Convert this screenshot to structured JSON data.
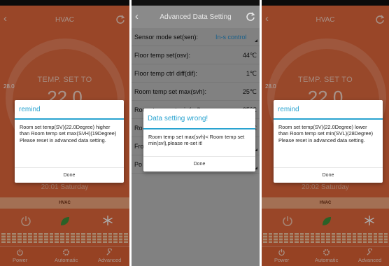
{
  "screen1": {
    "title": "HVAC",
    "temp_label": "TEMP. SET TO",
    "temp_value": "22.0",
    "left_temp": "28.0",
    "date": "20:01 Saturday",
    "hvac_bar": "HVAC",
    "nav": [
      "Power",
      "Automatic",
      "Advanced"
    ],
    "dialog": {
      "title": "remind",
      "message": "Room set temp(SV)(22.0Degree) higher than Room temp set max(SVH)(19Degree) Please reset in advanced data setting.",
      "button": "Done"
    }
  },
  "screen2": {
    "title": "Advanced Data Setting",
    "rows": [
      {
        "label": "Sensor mode set(sen):",
        "value": "In-s control"
      },
      {
        "label": "Floor temp set(osv):",
        "value": "44℃"
      },
      {
        "label": "Floor temp ctrl diff(dif):",
        "value": "1℃"
      },
      {
        "label": "Room temp set max(svh):",
        "value": "25℃"
      },
      {
        "label": "Room temp set min(svl):",
        "value": "25℃"
      },
      {
        "label": "Ro",
        "value": "℃"
      },
      {
        "label": "Fro",
        "value": ""
      },
      {
        "label": "Po",
        "value": ""
      }
    ],
    "dialog": {
      "title": "Data setting wrong!",
      "message": "Room temp set max(svh)< Room temp set min(svl),please re-set it!",
      "button": "Done"
    }
  },
  "screen3": {
    "title": "HVAC",
    "temp_label": "TEMP. SET TO",
    "temp_value": "22.0",
    "left_temp": "28.0",
    "date": "20:02 Saturday",
    "hvac_bar": "HVAC",
    "nav": [
      "Power",
      "Automatic",
      "Advanced"
    ],
    "dialog": {
      "title": "remind",
      "message": "Room set temp(SV)(22.0Degree) lower than Room temp set min(SVL)(28Degree) Please reset in advanced data setting.",
      "button": "Done"
    }
  },
  "icons": {
    "back": "chevron-left-icon",
    "refresh": "refresh-icon",
    "power": "power-icon",
    "automatic": "gear-icon",
    "advanced": "wrench-icon",
    "snowflake": "snowflake-icon",
    "leaf": "leaf-icon"
  },
  "colors": {
    "hvac_bg": "#e2683c",
    "dialog_accent": "#29a3d0",
    "settings_bg": "#bfbfbf"
  }
}
